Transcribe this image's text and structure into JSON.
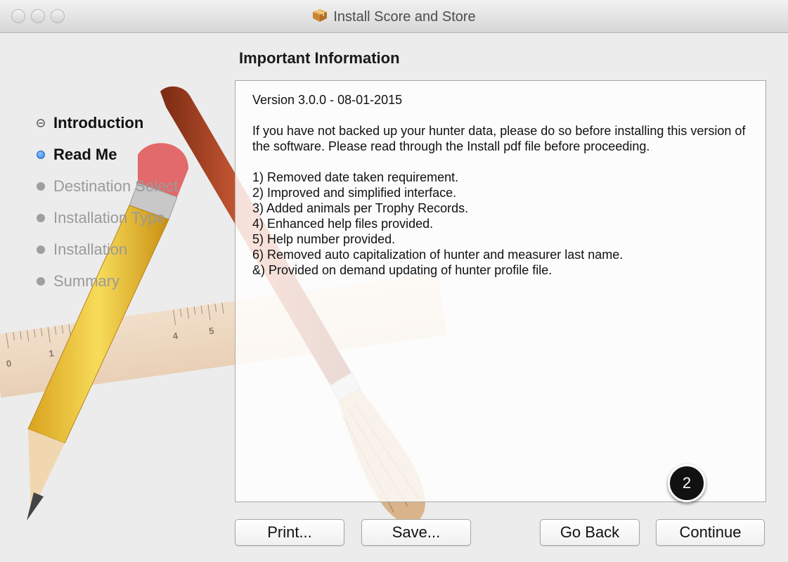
{
  "window": {
    "title": "Install Score and Store",
    "title_icon": "package-icon"
  },
  "page": {
    "heading": "Important Information"
  },
  "steps": [
    {
      "label": "Introduction",
      "state": "done"
    },
    {
      "label": "Read Me",
      "state": "current"
    },
    {
      "label": "Destination Select",
      "state": "pending"
    },
    {
      "label": "Installation Type",
      "state": "pending"
    },
    {
      "label": "Installation",
      "state": "pending"
    },
    {
      "label": "Summary",
      "state": "pending"
    }
  ],
  "content": {
    "version": "Version 3.0.0 - 08-01-2015",
    "notice": "If you have not backed up your hunter data, please do so before installing this version of the software. Please read through the Install pdf file before proceeding.",
    "changes": [
      "1) Removed date taken requirement.",
      "2) Improved and simplified interface.",
      "3) Added animals per Trophy Records.",
      "4) Enhanced help files provided.",
      "5) Help number provided.",
      "6) Removed auto capitalization of hunter and measurer last name.",
      "&) Provided on demand updating of hunter profile file."
    ]
  },
  "buttons": {
    "print": "Print...",
    "save": "Save...",
    "go_back": "Go Back",
    "continue": "Continue"
  },
  "annotation": {
    "badge": "2"
  },
  "ruler": {
    "tick_labels": [
      "0",
      "1",
      "4",
      "5"
    ]
  }
}
